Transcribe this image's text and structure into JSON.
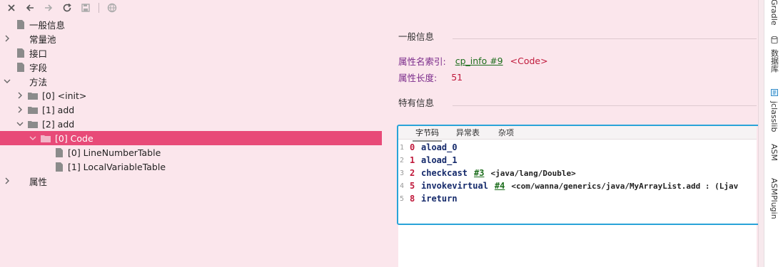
{
  "toolbar": {
    "icons": [
      "close-icon",
      "back-icon",
      "forward-icon",
      "refresh-icon",
      "save-icon",
      "globe-icon"
    ]
  },
  "tree": {
    "general_info": "一般信息",
    "constant_pool": "常量池",
    "interfaces": "接口",
    "fields": "字段",
    "methods": "方法",
    "method_0": "[0] <init>",
    "method_1": "[1] add",
    "method_2": "[2] add",
    "code": "[0] Code",
    "line_number_table": "[0] LineNumberTable",
    "local_variable_table": "[1] LocalVariableTable",
    "attributes": "属性"
  },
  "general": {
    "title": "一般信息",
    "name_index_label": "属性名索引:",
    "name_index_link": "cp_info #9",
    "name_index_value": "<Code>",
    "length_label": "属性长度:",
    "length_value": "51"
  },
  "specific": {
    "title": "特有信息",
    "tabs": [
      "字节码",
      "异常表",
      "杂项"
    ]
  },
  "bytecode": [
    {
      "line": "1",
      "offset": "0",
      "op": "aload_0",
      "arg": "",
      "comment": ""
    },
    {
      "line": "2",
      "offset": "1",
      "op": "aload_1",
      "arg": "",
      "comment": ""
    },
    {
      "line": "3",
      "offset": "2",
      "op": "checkcast",
      "arg": "#3",
      "comment": "<java/lang/Double>"
    },
    {
      "line": "4",
      "offset": "5",
      "op": "invokevirtual",
      "arg": "#4",
      "comment": "<com/wanna/generics/java/MyArrayList.add : (Ljav"
    },
    {
      "line": "5",
      "offset": "8",
      "op": "ireturn",
      "arg": "",
      "comment": ""
    }
  ],
  "sidebar": {
    "gradle": "Gradle",
    "database": "数据库",
    "jclasslib": "jclasslib",
    "asm": "ASM",
    "asmplugin": "ASMPlugin"
  },
  "colors": {
    "background": "#fbe6ec",
    "selection": "#e84a78",
    "highlight_border": "#29a3d8",
    "link": "#1d6e1d",
    "accent_red": "#c0193b",
    "label_purple": "#7a2a8a"
  }
}
